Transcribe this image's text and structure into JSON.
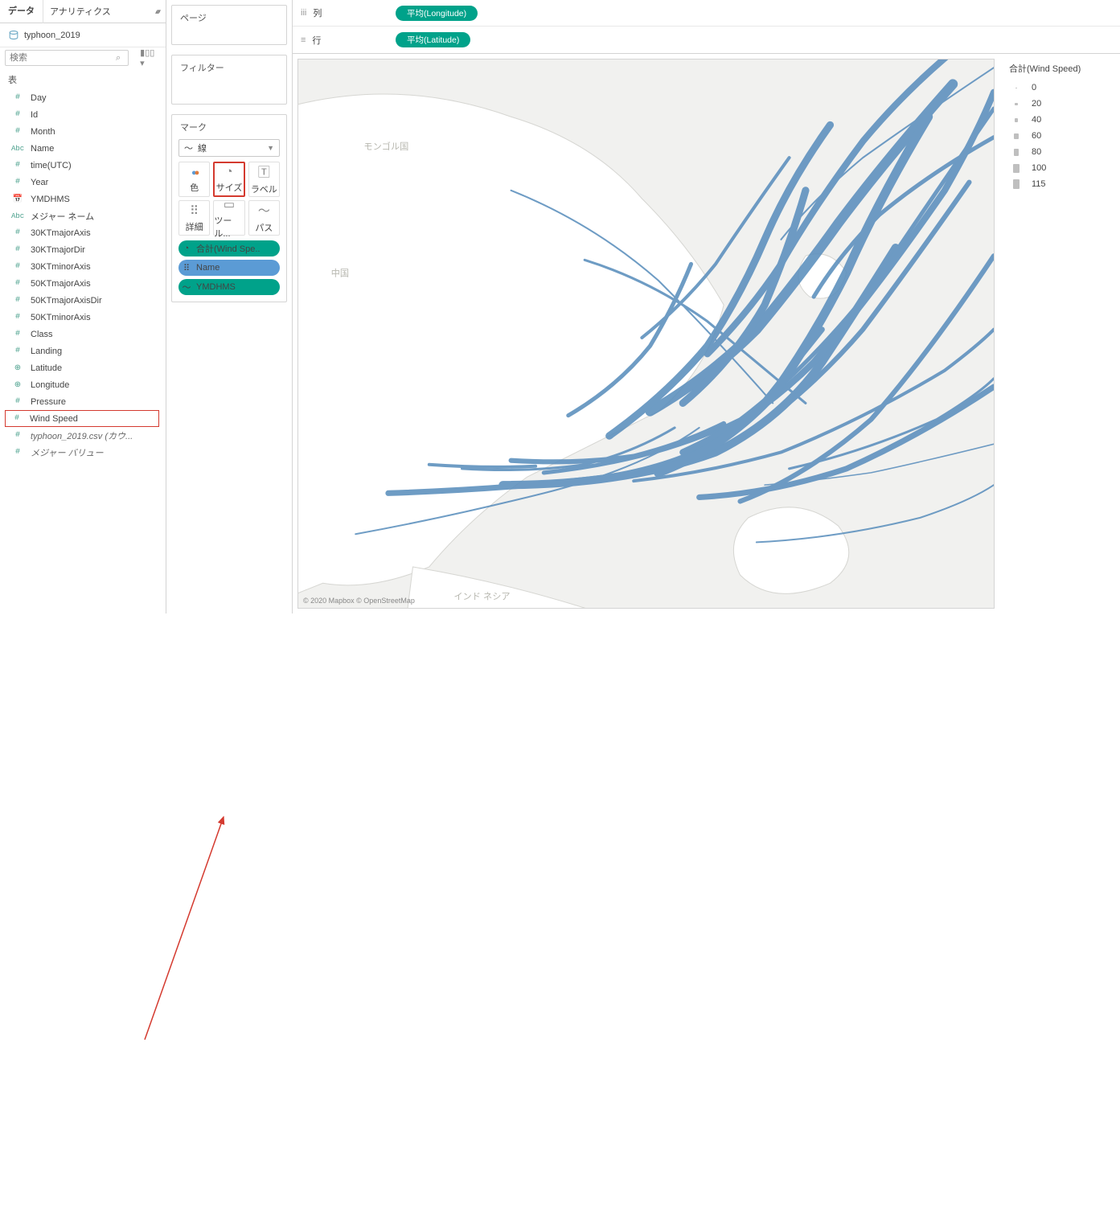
{
  "tabs": {
    "data": "データ",
    "analytics": "アナリティクス"
  },
  "datasource": "typhoon_2019",
  "search": {
    "placeholder": "検索"
  },
  "fields_header": "表",
  "fields": [
    {
      "icon": "#",
      "name": "Day"
    },
    {
      "icon": "#",
      "name": "Id"
    },
    {
      "icon": "#",
      "name": "Month"
    },
    {
      "icon": "Abc",
      "name": "Name"
    },
    {
      "icon": "#",
      "name": "time(UTC)"
    },
    {
      "icon": "#",
      "name": "Year"
    },
    {
      "icon": "cal",
      "name": "YMDHMS"
    },
    {
      "icon": "Abc",
      "name": "メジャー ネーム"
    },
    {
      "icon": "#",
      "name": "30KTmajorAxis"
    },
    {
      "icon": "#",
      "name": "30KTmajorDir"
    },
    {
      "icon": "#",
      "name": "30KTminorAxis"
    },
    {
      "icon": "#",
      "name": "50KTmajorAxis"
    },
    {
      "icon": "#",
      "name": "50KTmajorAxisDir"
    },
    {
      "icon": "#",
      "name": "50KTminorAxis"
    },
    {
      "icon": "#",
      "name": "Class"
    },
    {
      "icon": "#",
      "name": "Landing"
    },
    {
      "icon": "geo",
      "name": "Latitude"
    },
    {
      "icon": "geo",
      "name": "Longitude"
    },
    {
      "icon": "#",
      "name": "Pressure"
    },
    {
      "icon": "#",
      "name": "Wind Speed",
      "boxed": true
    },
    {
      "icon": "#",
      "name": "typhoon_2019.csv (カウ...",
      "italic": true
    },
    {
      "icon": "#",
      "name": "メジャー バリュー",
      "italic": true
    }
  ],
  "cards": {
    "pages": "ページ",
    "filters": "フィルター",
    "marks": "マーク"
  },
  "mark_type": "線",
  "mark_cells": {
    "color": "色",
    "size": "サイズ",
    "label": "ラベル",
    "detail": "詳細",
    "tooltip": "ツール...",
    "path": "パス"
  },
  "mark_pills": {
    "p1": "合計(Wind Spe..",
    "p2": "Name",
    "p3": "YMDHMS"
  },
  "shelf": {
    "columns_label": "列",
    "rows_label": "行",
    "columns_pill": "平均(Longitude)",
    "rows_pill": "平均(Latitude)"
  },
  "legend": {
    "title": "合計(Wind Speed)",
    "items": [
      {
        "v": "0",
        "h": 1
      },
      {
        "v": "20",
        "h": 3
      },
      {
        "v": "40",
        "h": 5
      },
      {
        "v": "60",
        "h": 7
      },
      {
        "v": "80",
        "h": 9
      },
      {
        "v": "100",
        "h": 11
      },
      {
        "v": "115",
        "h": 12
      }
    ]
  },
  "map": {
    "labels": {
      "mongolia": "モンゴル国",
      "china": "中国",
      "indonesia": "インド\nネシア"
    },
    "attribution": "© 2020 Mapbox © OpenStreetMap"
  }
}
